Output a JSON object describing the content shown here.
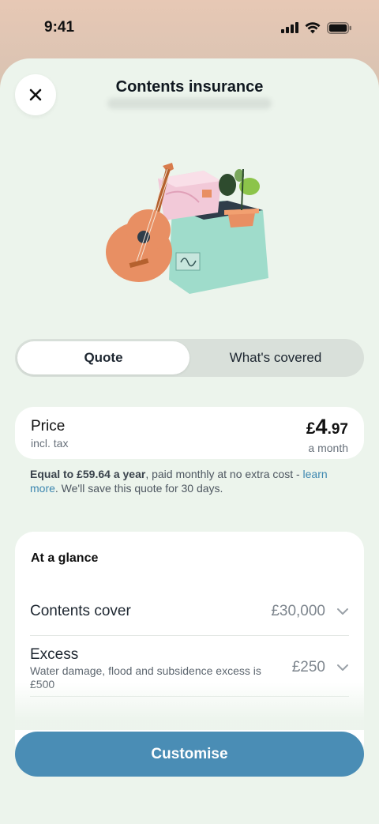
{
  "status_bar": {
    "time": "9:41"
  },
  "header": {
    "title": "Contents insurance"
  },
  "tabs": [
    {
      "label": "Quote",
      "active": true
    },
    {
      "label": "What's covered",
      "active": false
    }
  ],
  "price": {
    "label": "Price",
    "tax_note": "incl. tax",
    "currency": "£",
    "main": "4",
    "pence": ".97",
    "period": "a month"
  },
  "price_note": {
    "bold": "Equal to £59.64 a year",
    "text1": ", paid monthly at no extra cost - ",
    "link": "learn more",
    "text2": ". We'll save this quote for 30 days."
  },
  "at_a_glance": {
    "title": "At a glance",
    "rows": [
      {
        "label": "Contents cover",
        "value": "£30,000",
        "description": ""
      },
      {
        "label": "Excess",
        "value": "£250",
        "description": "Water damage, flood and subsidence excess is £500"
      }
    ]
  },
  "cta": {
    "label": "Customise"
  },
  "colors": {
    "accent": "#4a8db5",
    "sheet_bg": "#ecf4ec",
    "link": "#3d87b0"
  }
}
